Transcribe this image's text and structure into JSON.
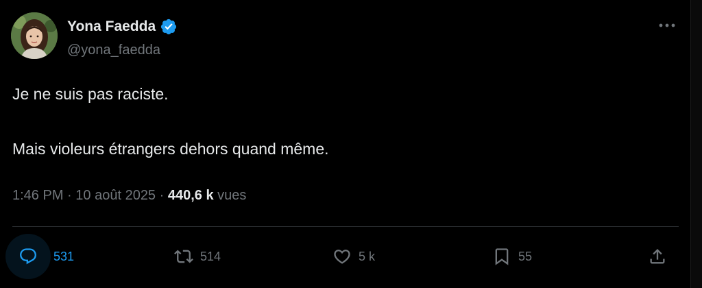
{
  "author": {
    "display_name": "Yona Faedda",
    "handle": "@yona_faedda",
    "verified": true
  },
  "post": {
    "lines": [
      "Je ne suis pas raciste.",
      "Mais violeurs étrangers dehors quand même."
    ]
  },
  "meta": {
    "time": "1:46 PM",
    "separator": "·",
    "date": "10 août 2025",
    "views_count": "440,6 k",
    "views_label": "vues"
  },
  "actions": {
    "replies": "531",
    "reposts": "514",
    "likes": "5 k",
    "bookmarks": "55"
  },
  "icons": {
    "verified": "verified-badge-icon",
    "more": "more-horizontal-icon",
    "reply": "reply-icon",
    "repost": "repost-icon",
    "like": "heart-icon",
    "bookmark": "bookmark-icon",
    "share": "share-icon"
  },
  "colors": {
    "background": "#000000",
    "text": "#e7e9ea",
    "secondary": "#71767b",
    "accent": "#1d9bf0",
    "divider": "#2f3336"
  }
}
